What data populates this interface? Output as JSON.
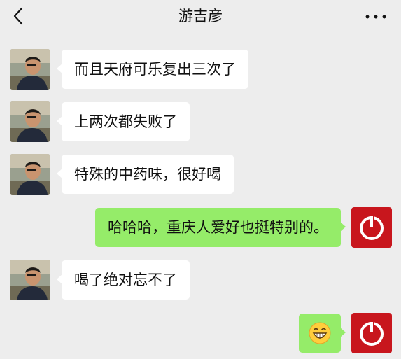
{
  "header": {
    "title": "游吉彦"
  },
  "messages": [
    {
      "from": "contact",
      "text": "而且天府可乐复出三次了"
    },
    {
      "from": "contact",
      "text": "上两次都失败了"
    },
    {
      "from": "contact",
      "text": "特殊的中药味，很好喝"
    },
    {
      "from": "me",
      "text": "哈哈哈，重庆人爱好也挺特别的。"
    },
    {
      "from": "contact",
      "text": "喝了绝对忘不了"
    },
    {
      "from": "me",
      "emoji": "grinning-face-icon"
    }
  ],
  "colors": {
    "background": "#ededed",
    "incoming_bubble": "#ffffff",
    "outgoing_bubble": "#95ec69",
    "my_avatar": "#c8161d"
  }
}
